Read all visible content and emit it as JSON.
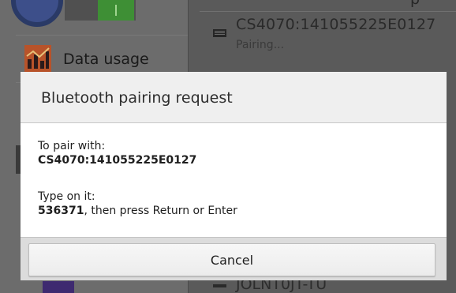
{
  "background": {
    "settings_items": [
      {
        "label": "Data usage",
        "icon": "bar-chart-icon"
      }
    ],
    "top_partial_text": "p",
    "bluetooth_device": {
      "name": "CS4070:141055225E0127",
      "status": "Pairing...",
      "icon": "keyboard-icon"
    },
    "bottom_partial_text": "JOLNT0JT-TU"
  },
  "dialog": {
    "title": "Bluetooth pairing request",
    "pair_with_label": "To pair with:",
    "device_name": "CS4070:141055225E0127",
    "type_on_label": "Type on it:",
    "passkey": "536371",
    "passkey_suffix": ", then press Return or Enter",
    "cancel_label": "Cancel"
  },
  "colors": {
    "toggle_on": "#3e8f35",
    "data_usage_icon": "#b8532a",
    "dim_overlay": "#5e5e5e"
  }
}
